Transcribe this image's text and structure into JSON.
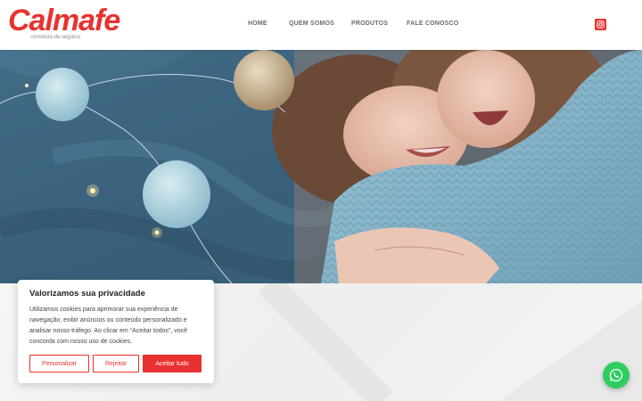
{
  "brand": {
    "name": "Calmafe",
    "tagline": "corretora de seguros",
    "accent": "#e8322f"
  },
  "nav": {
    "items": [
      {
        "label": "HOME"
      },
      {
        "label": "QUEM SOMOS"
      },
      {
        "label": "PRODUTOS"
      },
      {
        "label": "FALE CONOSCO"
      }
    ],
    "social_icon": "instagram-icon"
  },
  "hero": {
    "image_desc_icon": "hero-photo"
  },
  "cookie": {
    "title": "Valorizamos sua privacidade",
    "text": "Utilizamos cookies para aprimorar sua experiência de navegação, exibir anúncios ou conteúdo personalizado e analisar nosso tráfego. Ao clicar em “Aceitar todos”, você concorda com nosso uso de cookies.",
    "btn_customize": "Personalizar",
    "btn_reject": "Rejeitar",
    "btn_accept": "Aceitar tudo"
  },
  "whatsapp": {
    "icon": "whatsapp-icon",
    "color": "#2fcc5f"
  }
}
